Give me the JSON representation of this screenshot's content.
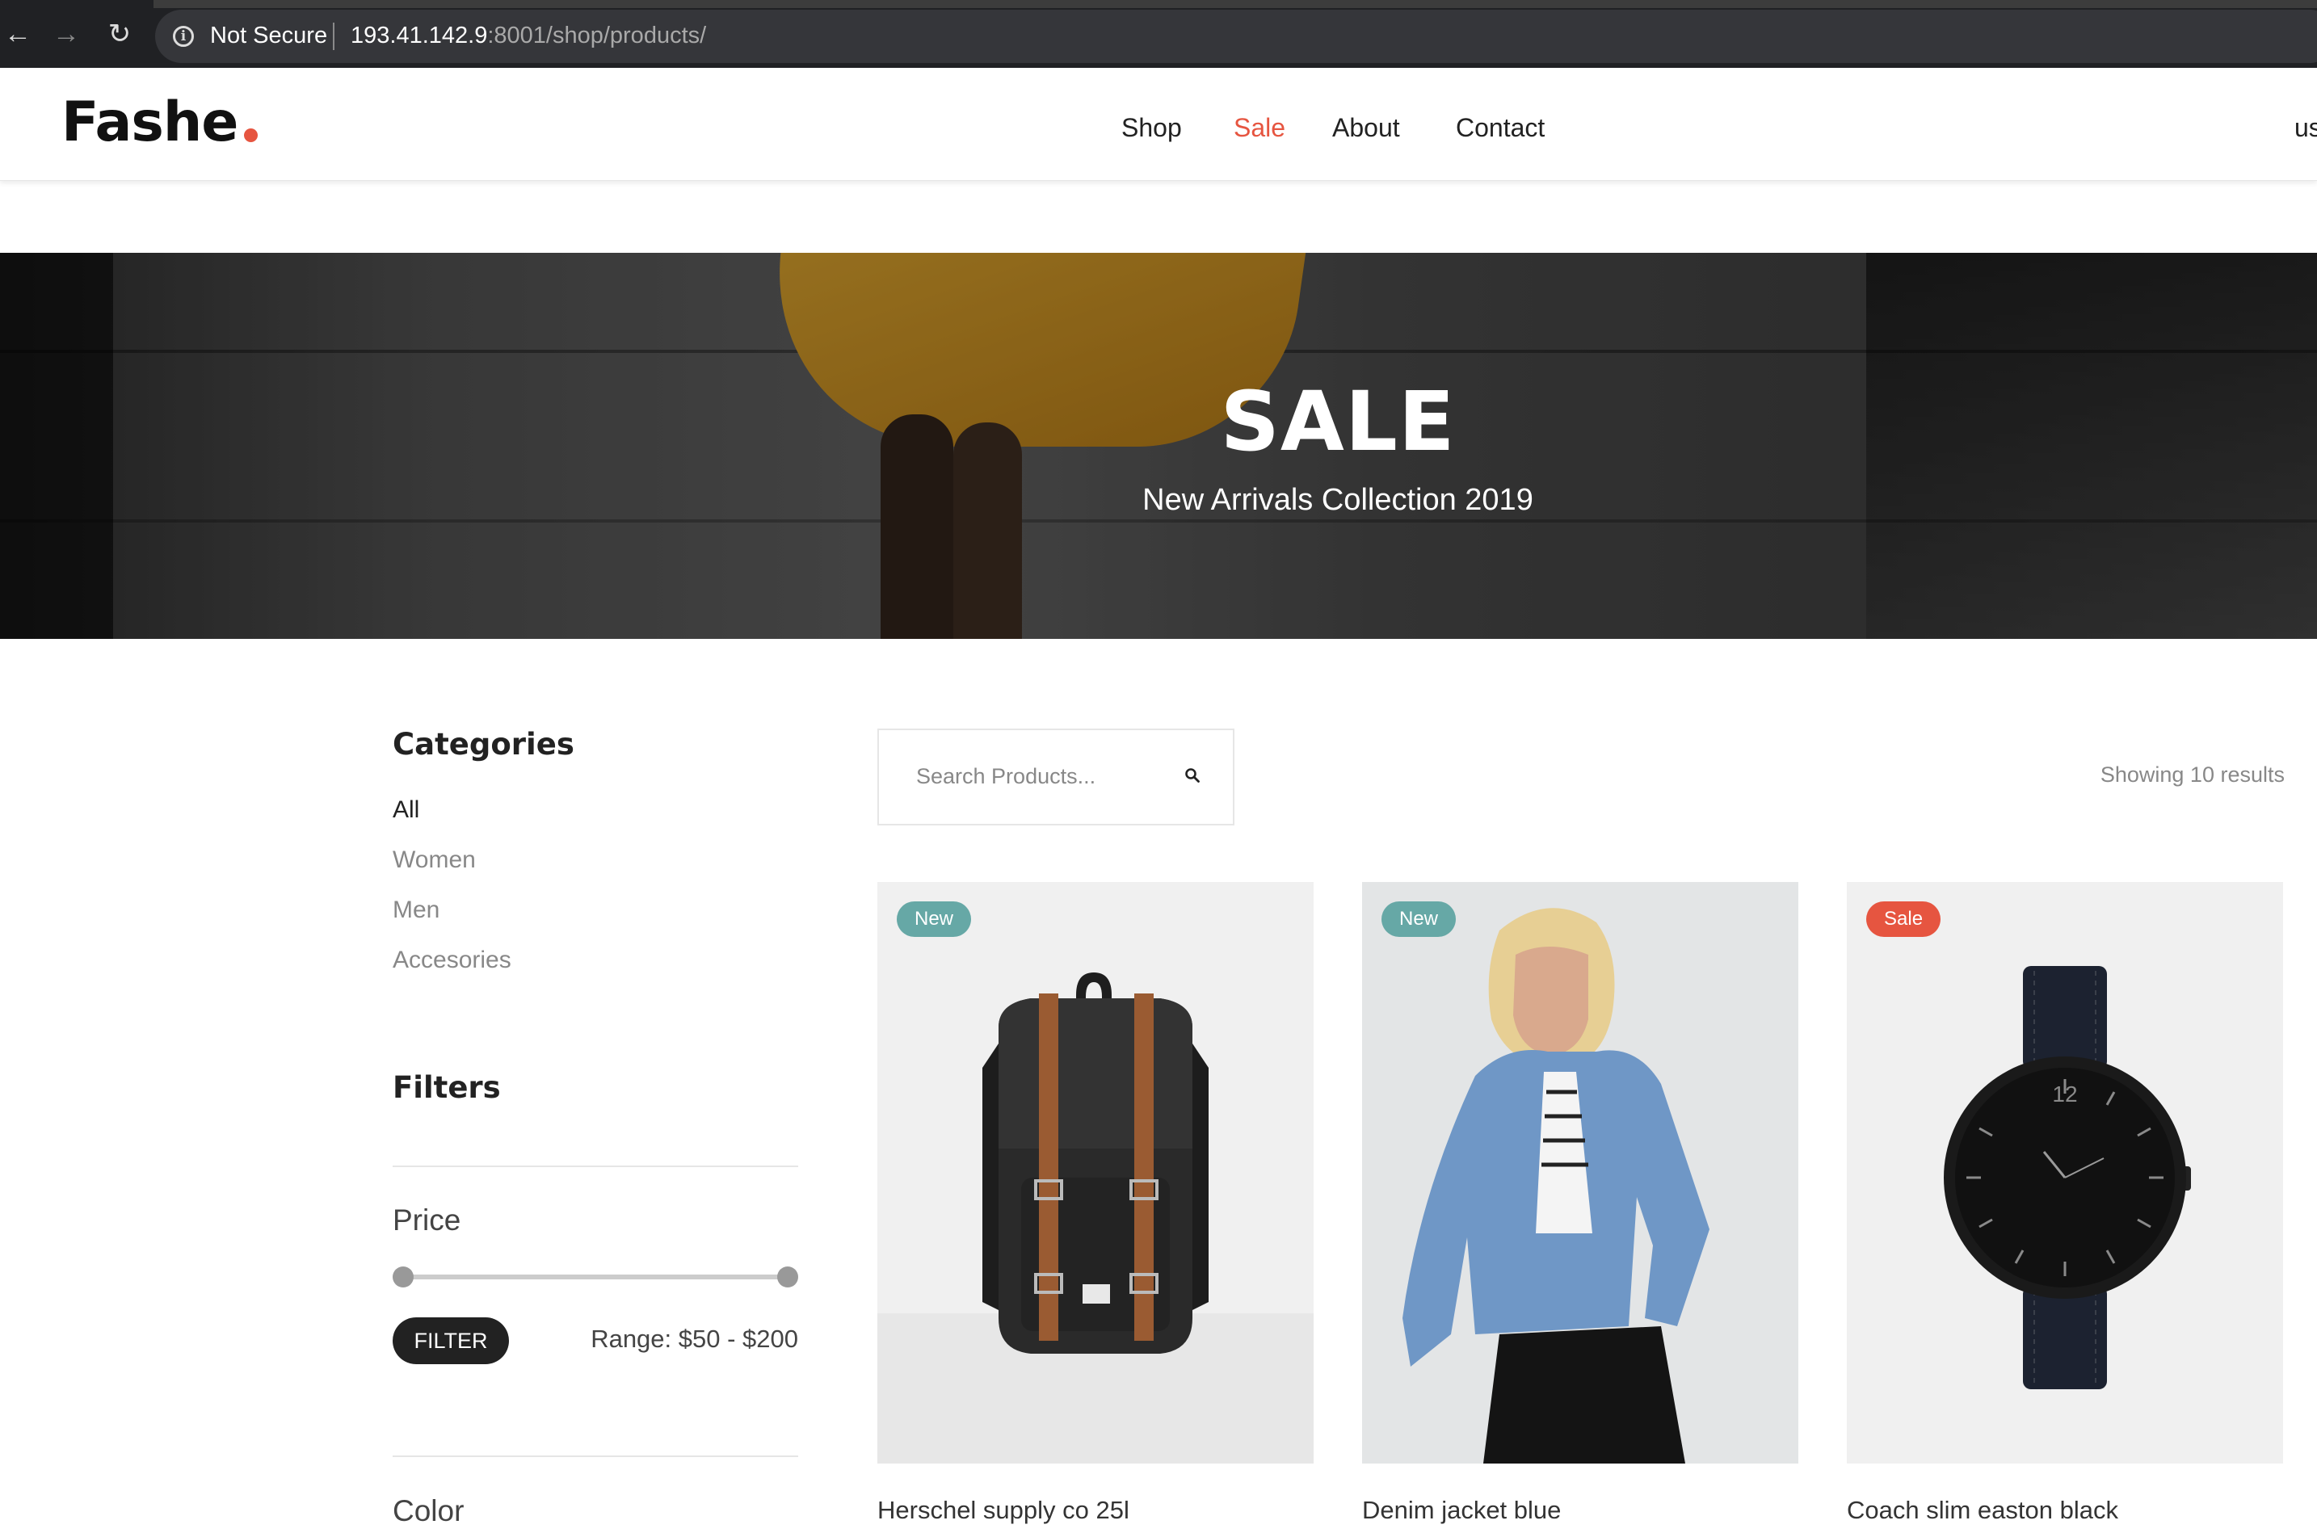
{
  "browser": {
    "security_label": "Not Secure",
    "url_host": "193.41.142.9",
    "url_path": ":8001/shop/products/"
  },
  "header": {
    "logo": "Fashe",
    "nav": [
      "Shop",
      "Sale",
      "About",
      "Contact"
    ],
    "active_nav": "Sale",
    "right_cut_text": "us"
  },
  "hero": {
    "title": "SALE",
    "subtitle": "New Arrivals Collection 2019"
  },
  "sidebar": {
    "categories_title": "Categories",
    "categories": [
      "All",
      "Women",
      "Men",
      "Accesories"
    ],
    "active_category": "All",
    "filters_title": "Filters",
    "price_label": "Price",
    "filter_button": "FILTER",
    "range_text": "Range: $50 - $200",
    "color_label": "Color"
  },
  "search": {
    "placeholder": "Search Products..."
  },
  "results_text": "Showing 10 results",
  "products": [
    {
      "name": "Herschel supply co 25l",
      "badge": "New",
      "image": "black-backpack-brown-straps"
    },
    {
      "name": "Denim jacket blue",
      "badge": "New",
      "image": "woman-in-denim-jacket"
    },
    {
      "name": "Coach slim easton black",
      "badge": "Sale",
      "image": "black-wristwatch"
    }
  ],
  "colors": {
    "accent": "#e65540",
    "badge_new": "#66a8a6",
    "badge_sale": "#e65540",
    "dark": "#222222"
  }
}
